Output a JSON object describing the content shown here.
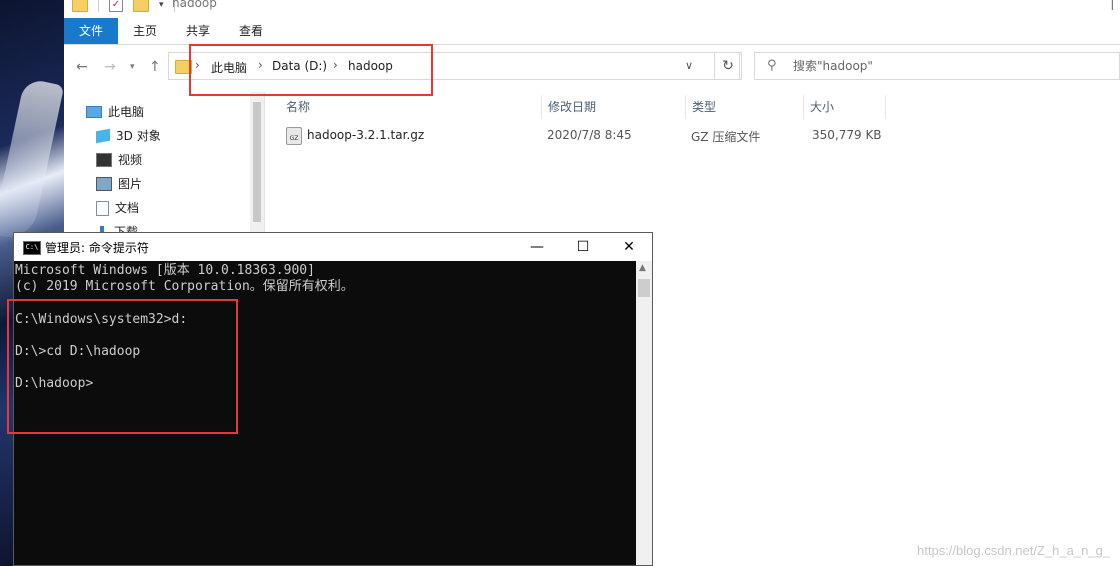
{
  "explorer": {
    "window_title": "hadoop",
    "ribbon_tabs": [
      "文件",
      "主页",
      "共享",
      "查看"
    ],
    "address": {
      "crumbs": [
        "此电脑",
        "Data (D:)",
        "hadoop"
      ]
    },
    "search": {
      "placeholder": "搜索\"hadoop\""
    },
    "nav_items": [
      {
        "label": "此电脑",
        "icon": "computer-icon"
      },
      {
        "label": "3D 对象",
        "icon": "cube-3d-icon"
      },
      {
        "label": "视频",
        "icon": "video-icon"
      },
      {
        "label": "图片",
        "icon": "pictures-icon"
      },
      {
        "label": "文档",
        "icon": "documents-icon"
      },
      {
        "label": "下载",
        "icon": "downloads-icon"
      }
    ],
    "columns": [
      "名称",
      "修改日期",
      "类型",
      "大小"
    ],
    "files": [
      {
        "name": "hadoop-3.2.1.tar.gz",
        "modified": "2020/7/8 8:45",
        "type": "GZ 压缩文件",
        "size": "350,779 KB",
        "icon": "gz-archive-icon"
      }
    ]
  },
  "cmd": {
    "title": "管理员: 命令提示符",
    "controls": [
      "—",
      "☐",
      "✕"
    ],
    "lines": [
      "Microsoft Windows [版本 10.0.18363.900]",
      "(c) 2019 Microsoft Corporation。保留所有权利。",
      "",
      "C:\\Windows\\system32>d:",
      "",
      "D:\\>cd D:\\hadoop",
      "",
      "D:\\hadoop>"
    ]
  },
  "colors": {
    "highlight_box": "#e53935",
    "ribbon_file_tab": "#1979ca"
  },
  "watermark": "https://blog.csdn.net/Z_h_a_n_g_"
}
